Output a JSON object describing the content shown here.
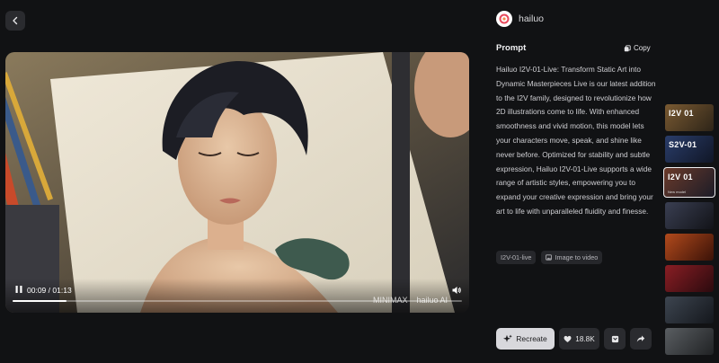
{
  "player": {
    "current_time": "00:09",
    "duration": "01:13",
    "time_separator": "/",
    "progress": 0.12,
    "watermark_left": "MINIMAX",
    "watermark_right": "hailuo AI"
  },
  "brand": {
    "name": "hailuo"
  },
  "prompt": {
    "title": "Prompt",
    "copy_label": "Copy",
    "text": "Hailuo I2V-01-Live: Transform Static Art into Dynamic Masterpieces Live is our latest addition to the I2V family, designed to revolutionize how 2D illustrations come to life. With enhanced smoothness and vivid motion, this model lets your characters move, speak, and shine like never before. Optimized for stability and subtle expression, Hailuo I2V-01-Live supports a wide range of artistic styles, empowering you to expand your creative expression and bring your art to life with unparalleled fluidity and finesse."
  },
  "tags": [
    {
      "label": "I2V-01-live"
    },
    {
      "label": "Image to video"
    }
  ],
  "actions": {
    "recreate_label": "Recreate",
    "like_count": "18.8K"
  },
  "thumbnails": [
    {
      "label": "I2V 01",
      "sub": "",
      "colors": [
        "#7a5a32",
        "#2d2418"
      ]
    },
    {
      "label": "S2V-01",
      "sub": "",
      "colors": [
        "#2a3d6a",
        "#101626"
      ]
    },
    {
      "label": "I2V 01",
      "sub": "New model",
      "colors": [
        "#6a3a2a",
        "#1c1c28"
      ]
    },
    {
      "label": "",
      "sub": "",
      "colors": [
        "#3a3f52",
        "#121318"
      ]
    },
    {
      "label": "",
      "sub": "",
      "colors": [
        "#b24a1c",
        "#3a1208"
      ]
    },
    {
      "label": "",
      "sub": "",
      "colors": [
        "#8a1e24",
        "#2a0a0e"
      ]
    },
    {
      "label": "",
      "sub": "",
      "colors": [
        "#3d4550",
        "#14171c"
      ]
    },
    {
      "label": "",
      "sub": "",
      "colors": [
        "#5a5e62",
        "#202224"
      ]
    }
  ],
  "colors": {
    "background": "#111214",
    "button_dark": "#2a2b2f",
    "recreate_bg": "#d8d8dc",
    "brand_accent": "#e8485c"
  },
  "icons": [
    "back-chevron-icon",
    "pause-icon",
    "volume-icon",
    "hailuo-logo-icon",
    "copy-icon",
    "image-icon",
    "sparkle-icon",
    "heart-icon",
    "bookmark-icon",
    "share-icon"
  ]
}
